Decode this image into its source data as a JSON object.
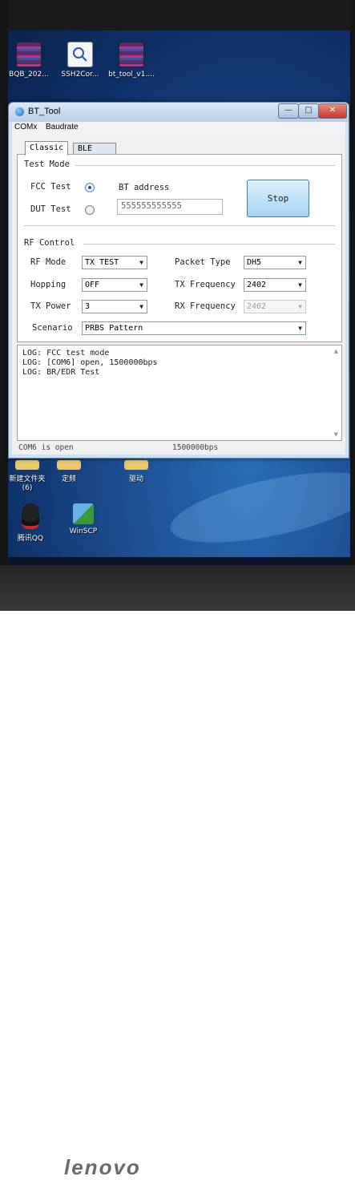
{
  "desktop": {
    "top_icons": [
      {
        "label": "BQB_202...",
        "icon": "winrar-archive-icon"
      },
      {
        "label": "SSH2Cor...",
        "icon": "document-search-icon"
      },
      {
        "label": "bt_tool_v1....",
        "icon": "winrar-archive-icon"
      }
    ],
    "bottom_icons": [
      {
        "label": "新建文件夹\n(6)",
        "icon": "folder-icon"
      },
      {
        "label": "定频",
        "icon": "folder-icon"
      },
      {
        "label": "驱动",
        "icon": "folder-icon"
      },
      {
        "label": "腾讯QQ",
        "icon": "qq-penguin-icon"
      },
      {
        "label": "WinSCP",
        "icon": "winscp-icon"
      }
    ],
    "bottom_labels": {
      "new_folder": "新建文件夹",
      "new_folder_count": "(6)",
      "dingpin": "定频",
      "qudong": "驱动",
      "qq": "腾讯QQ",
      "winscp": "WinSCP"
    }
  },
  "window": {
    "title": "BT_Tool",
    "buttons": {
      "minimize": "—",
      "maximize": "□",
      "close": "✕"
    },
    "menu": [
      "COMx",
      "Baudrate"
    ]
  },
  "tabs": {
    "classic": "Classic",
    "ble": "BLE",
    "active": "Classic"
  },
  "test_mode": {
    "group_title": "Test Mode",
    "fcc_label": "FCC Test",
    "dut_label": "DUT Test",
    "selected": "FCC Test",
    "bt_address_label": "BT address",
    "bt_address_value": "555555555555",
    "stop_button": "Stop"
  },
  "rf_control": {
    "group_title": "RF Control",
    "rf_mode_label": "RF Mode",
    "rf_mode_value": "TX TEST",
    "hopping_label": "Hopping",
    "hopping_value": "OFF",
    "tx_power_label": "TX Power",
    "tx_power_value": "3",
    "packet_type_label": "Packet Type",
    "packet_type_value": "DH5",
    "tx_freq_label": "TX Frequency",
    "tx_freq_value": "2402",
    "rx_freq_label": "RX Frequency",
    "rx_freq_value": "2402",
    "scenario_label": "Scenario",
    "scenario_value": "PRBS Pattern"
  },
  "log": {
    "lines": [
      "LOG: FCC test mode",
      "LOG: [COM6] open, 1500000bps",
      "LOG: BR/EDR Test"
    ]
  },
  "status": {
    "port": "COM6 is open",
    "baud": "1500000bps"
  },
  "brand": "lenovo",
  "colors": {
    "window_frame": "#cfe0f2",
    "stop_button": "#a6d3f1",
    "desktop": "#1d4f93",
    "close_button": "#c0392b"
  }
}
